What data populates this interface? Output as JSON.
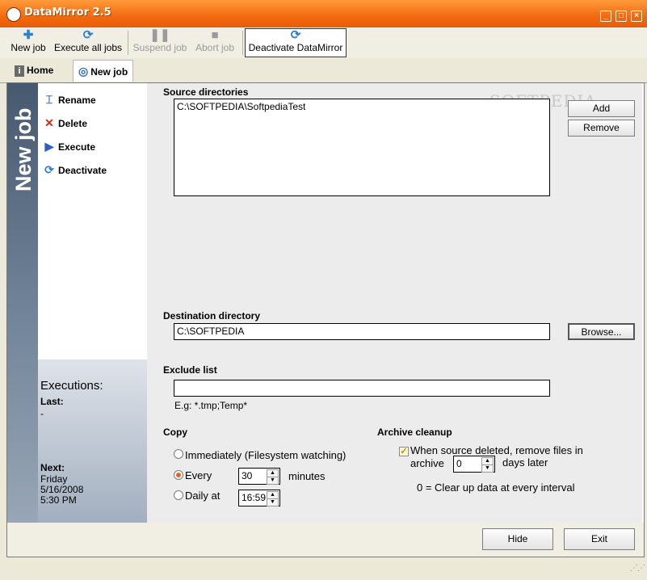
{
  "window": {
    "title": "DataMirror 2.5"
  },
  "toolbar": {
    "new_job": "New job",
    "execute_all": "Execute all jobs",
    "suspend": "Suspend job",
    "abort": "Abort job",
    "deactivate": "Deactivate DataMirror"
  },
  "tabs": {
    "home": "Home",
    "new_job": "New job"
  },
  "side": {
    "vertical_title": "New job",
    "items": [
      "Rename",
      "Delete",
      "Execute",
      "Deactivate"
    ]
  },
  "executions": {
    "heading": "Executions:",
    "last_label": "Last:",
    "last_value": "-",
    "next_label": "Next:",
    "next_day": "Friday",
    "next_date": "5/16/2008",
    "next_time": "5:30 PM"
  },
  "source": {
    "label": "Source directories",
    "entries": [
      "C:\\SOFTPEDIA\\SoftpediaTest"
    ],
    "add": "Add",
    "remove": "Remove"
  },
  "destination": {
    "label": "Destination directory",
    "value": "C:\\SOFTPEDIA",
    "browse": "Browse..."
  },
  "exclude": {
    "label": "Exclude list",
    "value": "",
    "hint": "E.g: *.tmp;Temp*"
  },
  "copy": {
    "label": "Copy",
    "immediately": "Immediately (Filesystem watching)",
    "every": "Every",
    "every_value": "30",
    "minutes": "minutes",
    "daily_at": "Daily at",
    "daily_value": "16:59",
    "selected": "every"
  },
  "archive": {
    "label": "Archive cleanup",
    "checkbox_text_1": "When source deleted, remove files in",
    "checkbox_text_2": "archive",
    "days_value": "0",
    "days_later": "days later",
    "note": "0 = Clear up data at every interval",
    "checked": true
  },
  "bottom": {
    "hide": "Hide",
    "exit": "Exit"
  },
  "watermark": "SOFTPEDIA",
  "colors": {
    "title_bar": "#f26a10",
    "side_panel": "#6f8297",
    "radio_selected": "#e7631b"
  }
}
